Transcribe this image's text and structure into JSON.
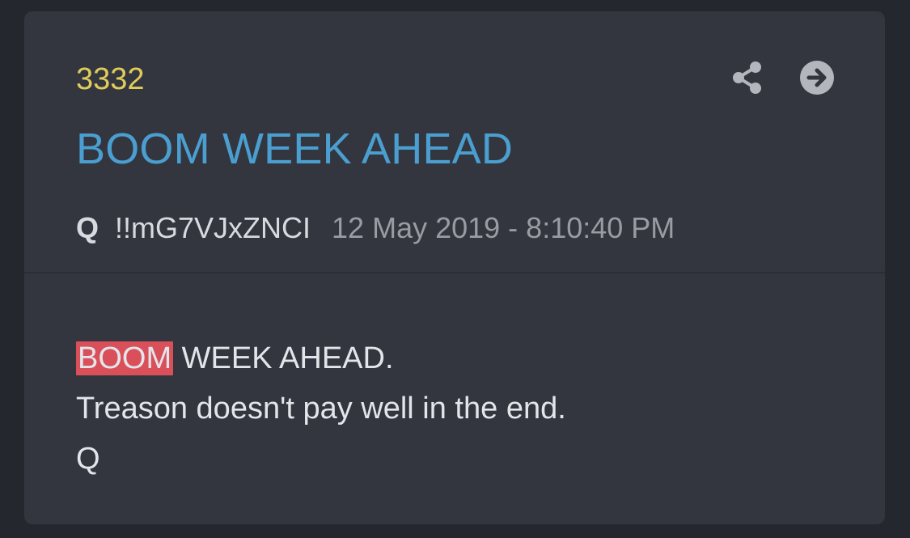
{
  "post": {
    "number": "3332",
    "title": "BOOM WEEK AHEAD",
    "author": "Q",
    "tripcode": "!!mG7VJxZNCI",
    "timestamp": "12 May 2019 - 8:10:40 PM",
    "body": {
      "highlight_word": "BOOM",
      "line1_rest": " WEEK AHEAD.",
      "line2": "Treason doesn't pay well in the end.",
      "line3": "Q"
    }
  },
  "actions": {
    "share_icon": "share-icon",
    "goto_icon": "arrow-right-circle-icon"
  },
  "colors": {
    "page_bg": "#25272e",
    "card_bg": "#33363e",
    "post_number": "#e0cc5a",
    "title": "#4a9fd0",
    "author": "#d8dadf",
    "tripcode": "#d8dadf",
    "timestamp": "#9a9ca3",
    "icon": "#b3b6bd",
    "body_text": "#e3e5ea",
    "highlight_bg": "#d9505a"
  }
}
